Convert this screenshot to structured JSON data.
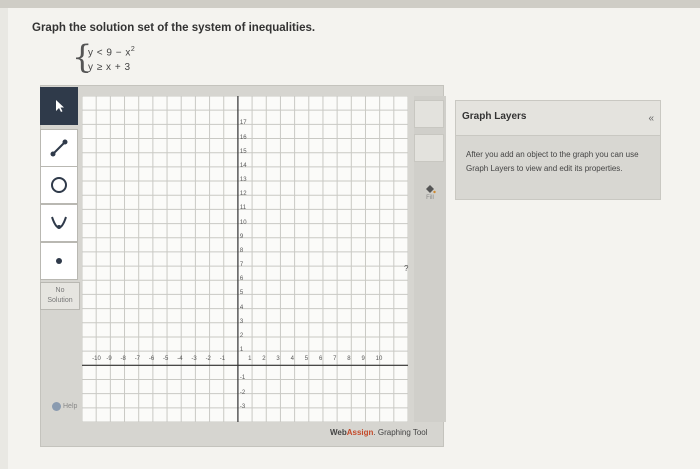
{
  "prompt": "Graph the solution set of the system of inequalities.",
  "system": {
    "line1_left": "y < 9 − x",
    "line1_exp": "2",
    "line2": "y ≥ x + 3"
  },
  "tools": [
    {
      "id": "pointer",
      "icon": "pointer-arrow-icon"
    },
    {
      "id": "line",
      "icon": "line-segment-icon"
    },
    {
      "id": "circle",
      "icon": "circle-icon"
    },
    {
      "id": "parabola",
      "icon": "parabola-icon"
    },
    {
      "id": "point",
      "icon": "point-icon"
    }
  ],
  "no_solution_label": "No\nSolution",
  "help_label": "Help",
  "fill_label": "Fill",
  "question_mark": "?",
  "layers": {
    "title": "Graph Layers",
    "collapse": "«",
    "body": "After you add an object to the graph you can use Graph Layers to view and edit its properties."
  },
  "branding": {
    "part1": "Web",
    "part2": "Assign",
    "part3": ". Graphing Tool"
  },
  "axes": {
    "x_ticks": [
      "-10",
      "-9",
      "-8",
      "-7",
      "-6",
      "-5",
      "-4",
      "-3",
      "-2",
      "-1",
      "1",
      "2",
      "3",
      "4",
      "5",
      "6",
      "7",
      "8",
      "9",
      "10"
    ],
    "y_ticks": [
      "17",
      "16",
      "15",
      "14",
      "13",
      "12",
      "11",
      "10",
      "9",
      "8",
      "7",
      "6",
      "5",
      "4",
      "3",
      "2",
      "1",
      "-1",
      "-2",
      "-3"
    ]
  },
  "colors": {
    "accent": "#c44a2a",
    "active_tool": "#2f3a4a"
  }
}
